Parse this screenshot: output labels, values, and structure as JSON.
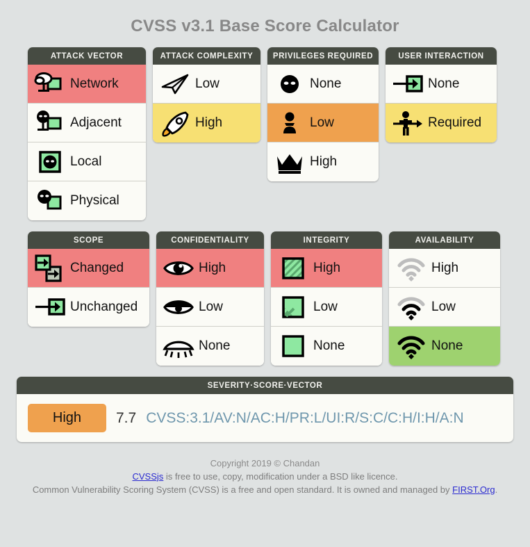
{
  "page": {
    "title": "CVSS v3.1 Base Score Calculator",
    "background": "#dfe2e2"
  },
  "colors": {
    "header": "#464b42",
    "selected_red": "#f08080",
    "selected_yellow": "#f7e073",
    "selected_orange": "#efa14e",
    "selected_green": "#9ed26f",
    "row_background": "#fbfbf6",
    "vector_text": "#6f97ad",
    "title_text": "#888888"
  },
  "metrics": [
    {
      "id": "attack-vector",
      "header": "ATTACK VECTOR",
      "options": [
        {
          "label": "Network",
          "icon": "cloud-monitor-icon",
          "selected": true,
          "state": "sel-red"
        },
        {
          "label": "Adjacent",
          "icon": "ninja-monitor-icon",
          "selected": false,
          "state": ""
        },
        {
          "label": "Local",
          "icon": "ninja-in-box-icon",
          "selected": false,
          "state": ""
        },
        {
          "label": "Physical",
          "icon": "ninja-square-icon",
          "selected": false,
          "state": ""
        }
      ]
    },
    {
      "id": "attack-complexity",
      "header": "ATTACK COMPLEXITY",
      "options": [
        {
          "label": "Low",
          "icon": "paper-plane-icon",
          "selected": false,
          "state": ""
        },
        {
          "label": "High",
          "icon": "rocket-icon",
          "selected": true,
          "state": "sel-yellow"
        }
      ]
    },
    {
      "id": "privileges-required",
      "header": "PRIVILEGES REQUIRED",
      "options": [
        {
          "label": "None",
          "icon": "ninja-head-icon",
          "selected": false,
          "state": ""
        },
        {
          "label": "Low",
          "icon": "chess-pawn-icon",
          "selected": true,
          "state": "sel-orange"
        },
        {
          "label": "High",
          "icon": "crown-icon",
          "selected": false,
          "state": ""
        }
      ]
    },
    {
      "id": "user-interaction",
      "header": "USER INTERACTION",
      "options": [
        {
          "label": "None",
          "icon": "arrow-into-box-icon",
          "selected": false,
          "state": ""
        },
        {
          "label": "Required",
          "icon": "person-arrow-icon",
          "selected": true,
          "state": "sel-yellow"
        }
      ]
    },
    {
      "id": "scope",
      "header": "SCOPE",
      "options": [
        {
          "label": "Changed",
          "icon": "two-boxes-arrow-icon",
          "selected": true,
          "state": "sel-red"
        },
        {
          "label": "Unchanged",
          "icon": "arrow-into-box-icon",
          "selected": false,
          "state": ""
        }
      ]
    },
    {
      "id": "confidentiality",
      "header": "CONFIDENTIALITY",
      "options": [
        {
          "label": "High",
          "icon": "eye-open-icon",
          "selected": true,
          "state": "sel-red"
        },
        {
          "label": "Low",
          "icon": "eye-half-icon",
          "selected": false,
          "state": ""
        },
        {
          "label": "None",
          "icon": "eye-closed-icon",
          "selected": false,
          "state": ""
        }
      ]
    },
    {
      "id": "integrity",
      "header": "INTEGRITY",
      "options": [
        {
          "label": "High",
          "icon": "square-hatched-full-icon",
          "selected": true,
          "state": "sel-red"
        },
        {
          "label": "Low",
          "icon": "square-hatched-part-icon",
          "selected": false,
          "state": ""
        },
        {
          "label": "None",
          "icon": "square-plain-icon",
          "selected": false,
          "state": ""
        }
      ]
    },
    {
      "id": "availability",
      "header": "AVAILABILITY",
      "options": [
        {
          "label": "High",
          "icon": "wifi-empty-icon",
          "selected": false,
          "state": ""
        },
        {
          "label": "Low",
          "icon": "wifi-half-icon",
          "selected": false,
          "state": ""
        },
        {
          "label": "None",
          "icon": "wifi-full-icon",
          "selected": true,
          "state": "sel-green"
        }
      ]
    }
  ],
  "severity": {
    "header": "SEVERITY·SCORE·VECTOR",
    "rating": "High",
    "score": "7.7",
    "vector": "CVSS:3.1/AV:N/AC:H/PR:L/UI:R/S:C/C:H/I:H/A:N"
  },
  "footer": {
    "line1": "Copyright 2019 © Chandan",
    "line2_link": "CVSSjs",
    "line2_rest": " is free to use, copy, modification under a BSD like licence.",
    "line3_pre": "Common Vulnerability Scoring System (CVSS) is a free and open standard. It is owned and managed by ",
    "line3_link": "FIRST.Org",
    "line3_post": "."
  }
}
